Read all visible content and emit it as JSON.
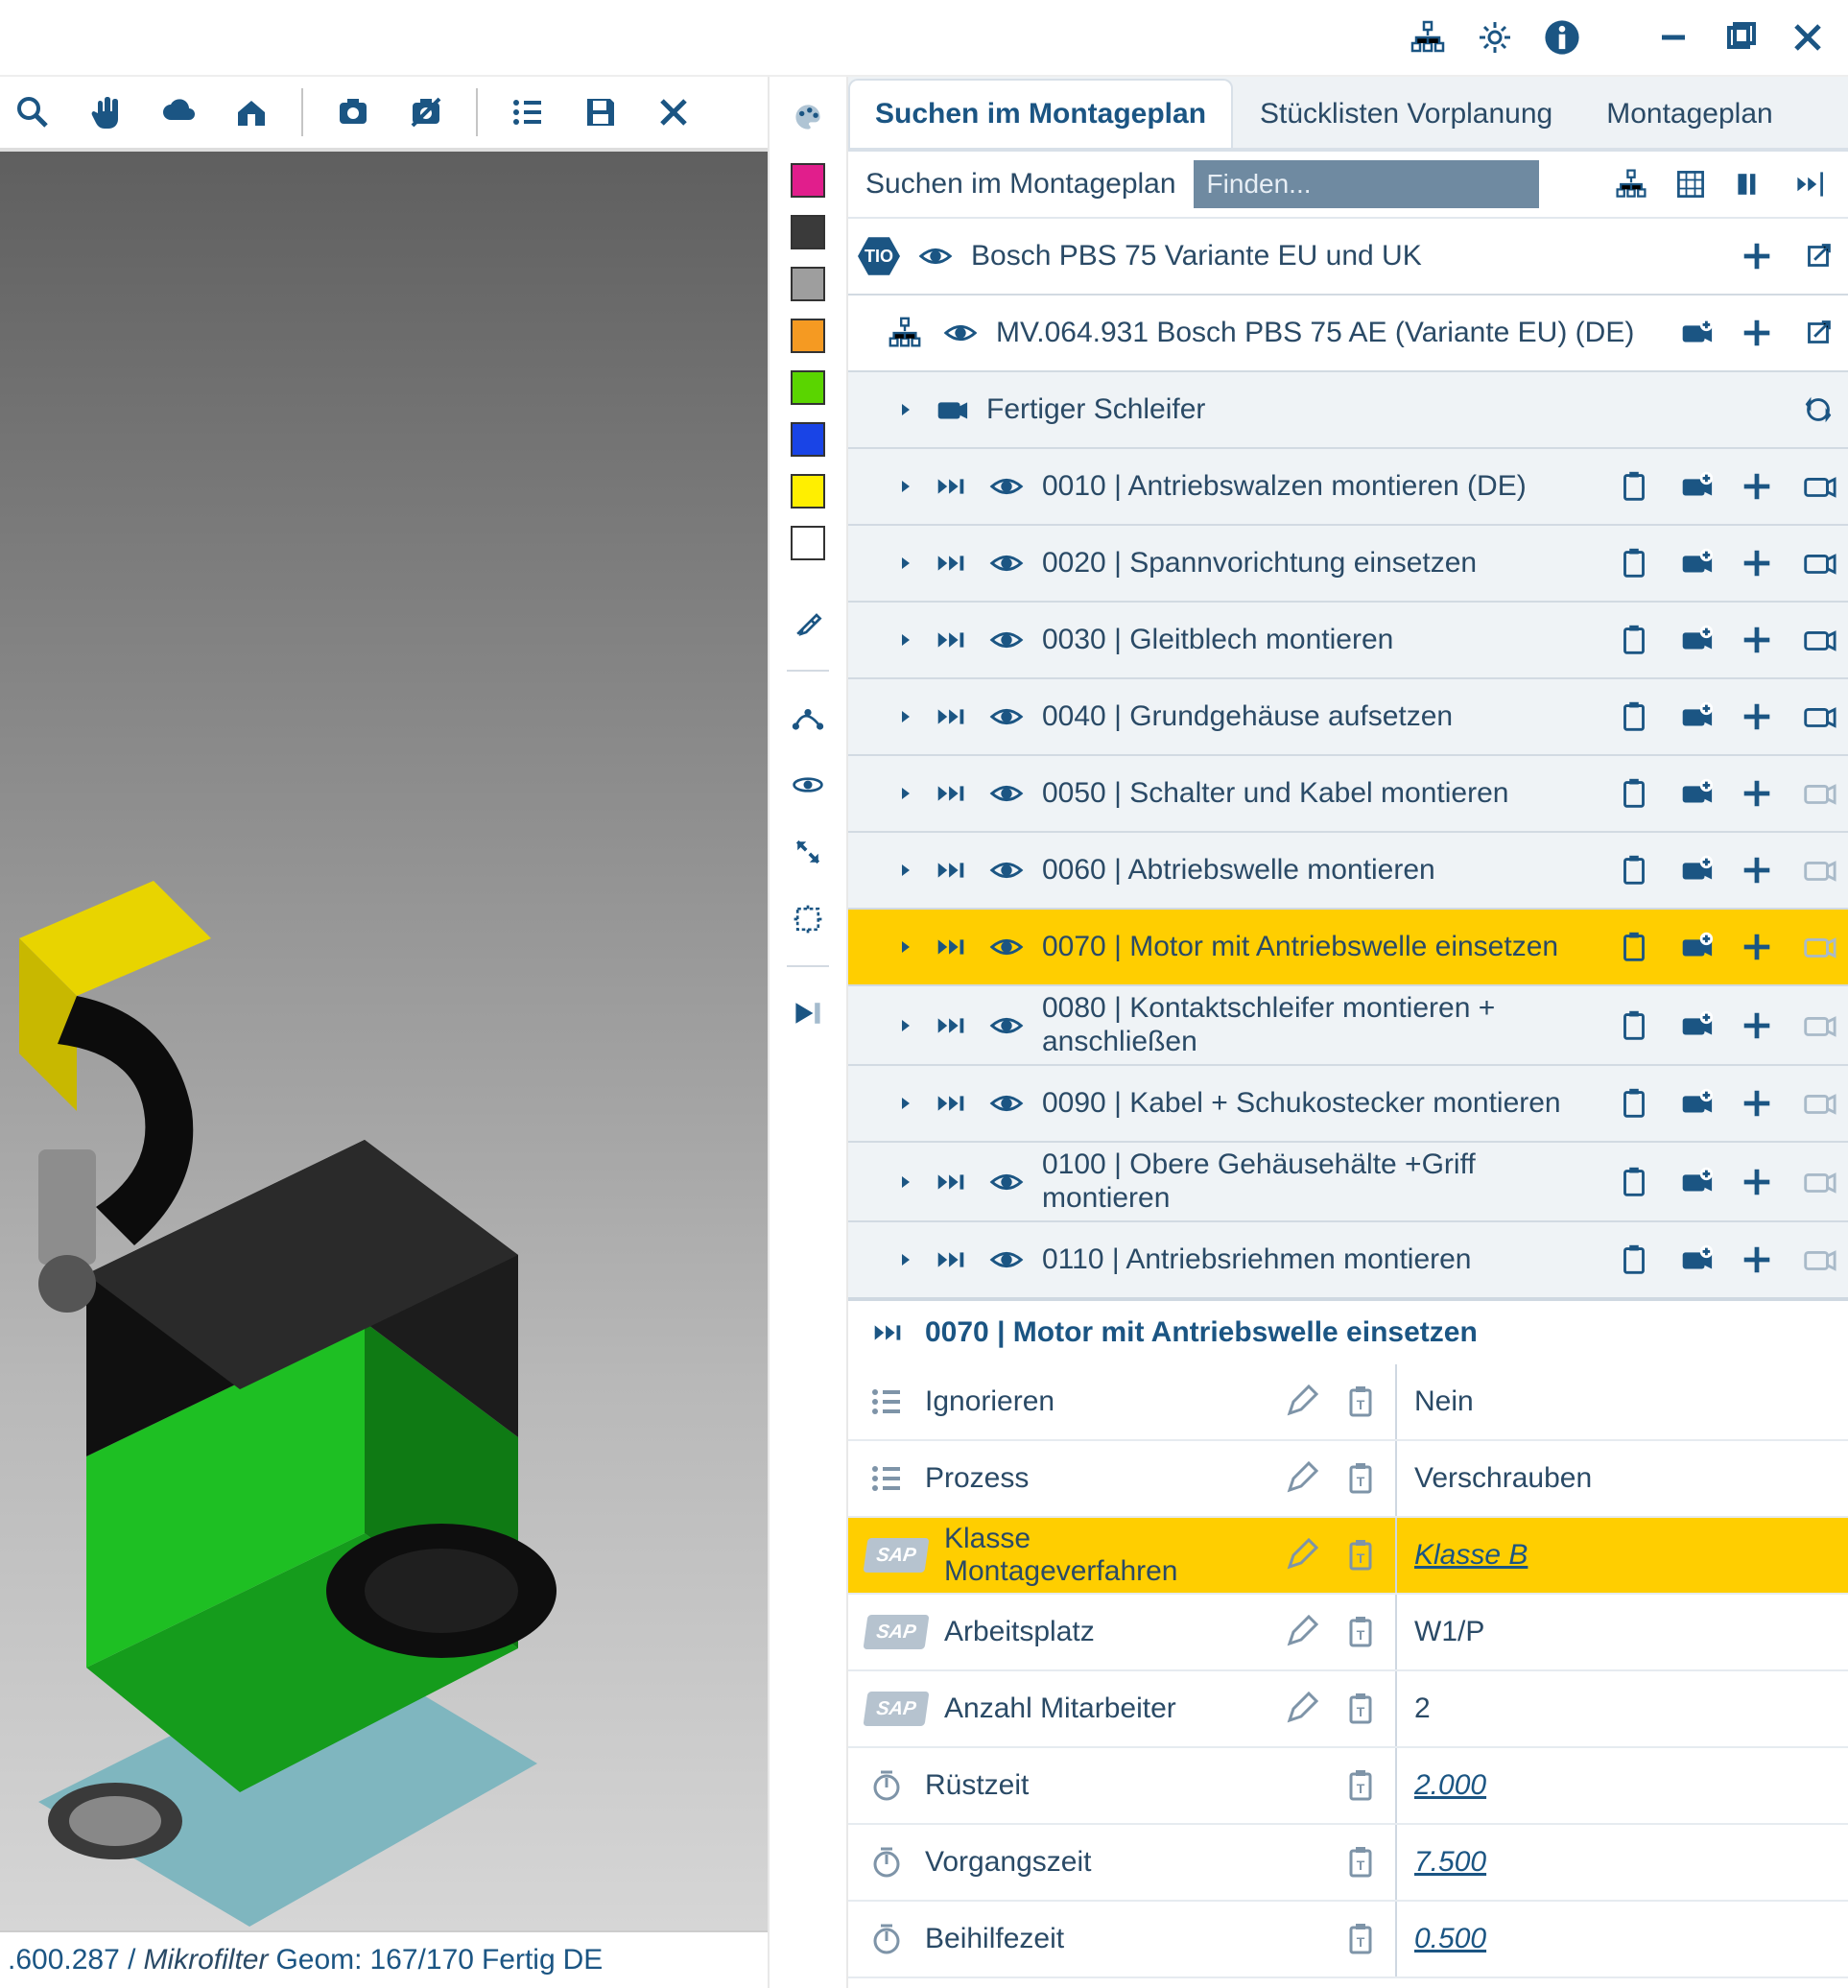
{
  "titlebar": {},
  "viewport": {
    "status": {
      "part": ".600.287 /",
      "filter": "Mikrofilter",
      "geom_label": "Geom:",
      "geom": "167/170",
      "state": "Fertig",
      "lang": "DE"
    }
  },
  "colors": [
    "#E11E8C",
    "#3A3A3A",
    "#9E9E9E",
    "#F59A22",
    "#5AD500",
    "#1944E6",
    "#FFEF00",
    "#FFFFFF"
  ],
  "tabs": {
    "t1": "Suchen im Montageplan",
    "t2": "Stücklisten Vorplanung",
    "t3": "Montageplan"
  },
  "search": {
    "label": "Suchen im Montageplan",
    "placeholder": "Finden..."
  },
  "tree": {
    "root": {
      "badge": "TIO",
      "label": "Bosch PBS 75 Variante EU und UK"
    },
    "variant": {
      "label": "MV.064.931 Bosch PBS 75 AE (Variante EU) (DE)"
    },
    "group": {
      "label": "Fertiger Schleifer"
    },
    "ops": [
      {
        "label": "0010 |  Antriebswalzen montieren (DE)",
        "cam": false
      },
      {
        "label": "0020 | Spannvorichtung einsetzen",
        "cam": false
      },
      {
        "label": "0030 | Gleitblech montieren",
        "cam": false
      },
      {
        "label": "0040 | Grundgehäuse aufsetzen",
        "cam": false
      },
      {
        "label": "0050 | Schalter und Kabel montieren",
        "cam": true
      },
      {
        "label": "0060 | Abtriebswelle montieren",
        "cam": true
      },
      {
        "label": "0070 | Motor mit Antriebswelle einsetzen",
        "cam": true,
        "selected": true
      },
      {
        "label": "0080 | Kontaktschleifer montieren + anschließen",
        "cam": true
      },
      {
        "label": "0090 | Kabel + Schukostecker montieren",
        "cam": true
      },
      {
        "label": "0100 | Obere Gehäusehälte +Griff montieren",
        "cam": true
      },
      {
        "label": "0110 | Antriebsriehmen montieren",
        "cam": true
      }
    ]
  },
  "detail": {
    "title": "0070 | Motor mit Antriebswelle einsetzen",
    "rows": [
      {
        "kind": "list",
        "key": "Ignorieren",
        "value": "Nein",
        "edit": true
      },
      {
        "kind": "list",
        "key": "Prozess",
        "value": "Verschrauben",
        "edit": true
      },
      {
        "kind": "sap",
        "key": "Klasse Montageverfahren",
        "value": "Klasse B",
        "edit": true,
        "link": true,
        "selected": true
      },
      {
        "kind": "sap",
        "key": "Arbeitsplatz",
        "value": "W1/P",
        "edit": true
      },
      {
        "kind": "sap",
        "key": "Anzahl Mitarbeiter",
        "value": "2",
        "edit": true
      },
      {
        "kind": "timer",
        "key": "Rüstzeit",
        "value": "2.000",
        "link": true
      },
      {
        "kind": "timer",
        "key": "Vorgangszeit",
        "value": "7.500",
        "link": true
      },
      {
        "kind": "timer",
        "key": "Beihilfezeit",
        "value": "0.500",
        "link": true
      }
    ]
  }
}
